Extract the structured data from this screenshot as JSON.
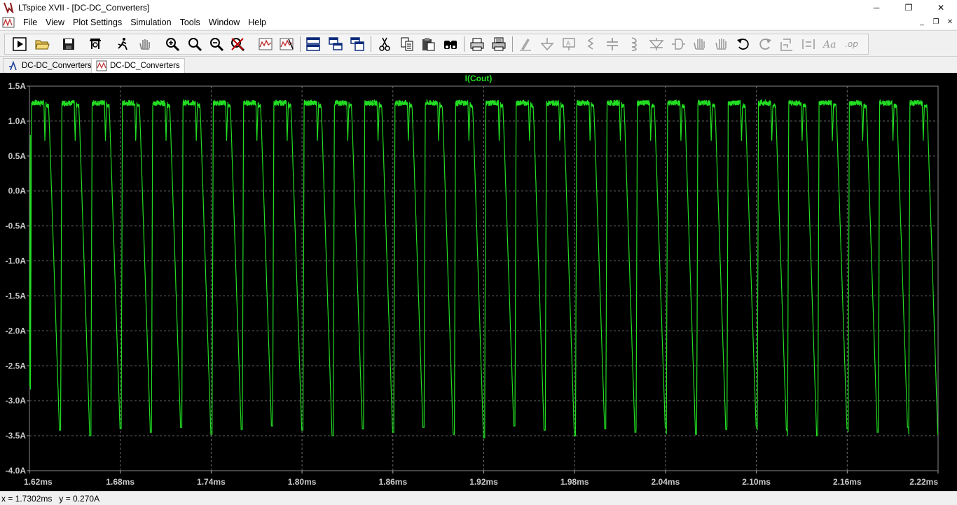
{
  "window": {
    "title": "LTspice XVII - [DC-DC_Converters]",
    "controls": {
      "minimize": "─",
      "maximize": "❐",
      "close": "✕"
    }
  },
  "menu": {
    "items": [
      {
        "label": "File"
      },
      {
        "label": "View"
      },
      {
        "label": "Plot Settings"
      },
      {
        "label": "Simulation"
      },
      {
        "label": "Tools"
      },
      {
        "label": "Window"
      },
      {
        "label": "Help"
      }
    ],
    "mdi_controls": {
      "minimize": "_",
      "restore": "❐",
      "close": "✕"
    }
  },
  "toolbar": {
    "icons": [
      "run-icon",
      "open-icon",
      "save-icon",
      "control-panel-icon",
      "run-sim-icon",
      "pan-hand-icon",
      "zoom-in-icon",
      "zoom-area-icon",
      "zoom-out-icon",
      "zoom-cancel-icon",
      "autorange-icon",
      "delete-trace-icon",
      "tile-horizontal-icon",
      "cascade-icon",
      "tile-vertical-icon",
      "cut-icon",
      "copy-icon",
      "paste-icon",
      "find-icon",
      "print-preview-icon",
      "print-icon",
      "draw-wire-icon",
      "ground-icon",
      "label-net-icon",
      "resistor-icon",
      "capacitor-icon",
      "inductor-icon",
      "diode-icon",
      "component-icon",
      "move-icon",
      "drag-icon",
      "undo-icon",
      "redo-icon",
      "rotate-icon",
      "mirror-icon",
      "text-icon",
      "spice-directive-icon"
    ]
  },
  "tabs": [
    {
      "label": "DC-DC_Converters",
      "icon": "schematic-icon",
      "active": false
    },
    {
      "label": "DC-DC_Converters",
      "icon": "waveform-icon",
      "active": true
    }
  ],
  "plot": {
    "trace_name": "I(Cout)",
    "trace_color": "#22dd22",
    "background": "#000000",
    "grid_color": "#6e6e6e"
  },
  "chart_data": {
    "type": "line",
    "title": "I(Cout)",
    "xlabel": "",
    "ylabel": "",
    "xlim": [
      1.62,
      2.22
    ],
    "ylim": [
      -4.0,
      1.5
    ],
    "x_unit": "ms",
    "y_unit": "A",
    "x_ticks": [
      "1.62ms",
      "1.68ms",
      "1.74ms",
      "1.80ms",
      "1.86ms",
      "1.92ms",
      "1.98ms",
      "2.04ms",
      "2.10ms",
      "2.16ms",
      "2.22ms"
    ],
    "y_ticks": [
      "1.5A",
      "1.0A",
      "0.5A",
      "0.0A",
      "-0.5A",
      "-1.0A",
      "-1.5A",
      "-2.0A",
      "-2.5A",
      "-3.0A",
      "-3.5A",
      "-4.0A"
    ],
    "grid": true,
    "series": [
      {
        "name": "I(Cout)",
        "color": "#22dd22",
        "waveform": "periodic sawtooth",
        "period_ms": 0.02,
        "high_level_A": 1.22,
        "low_level_A": [
          -3.42,
          -3.5
        ],
        "cycles": 30
      }
    ]
  },
  "status": {
    "x_readout": "x = 1.7302ms",
    "y_readout": "y = 0.270A"
  }
}
